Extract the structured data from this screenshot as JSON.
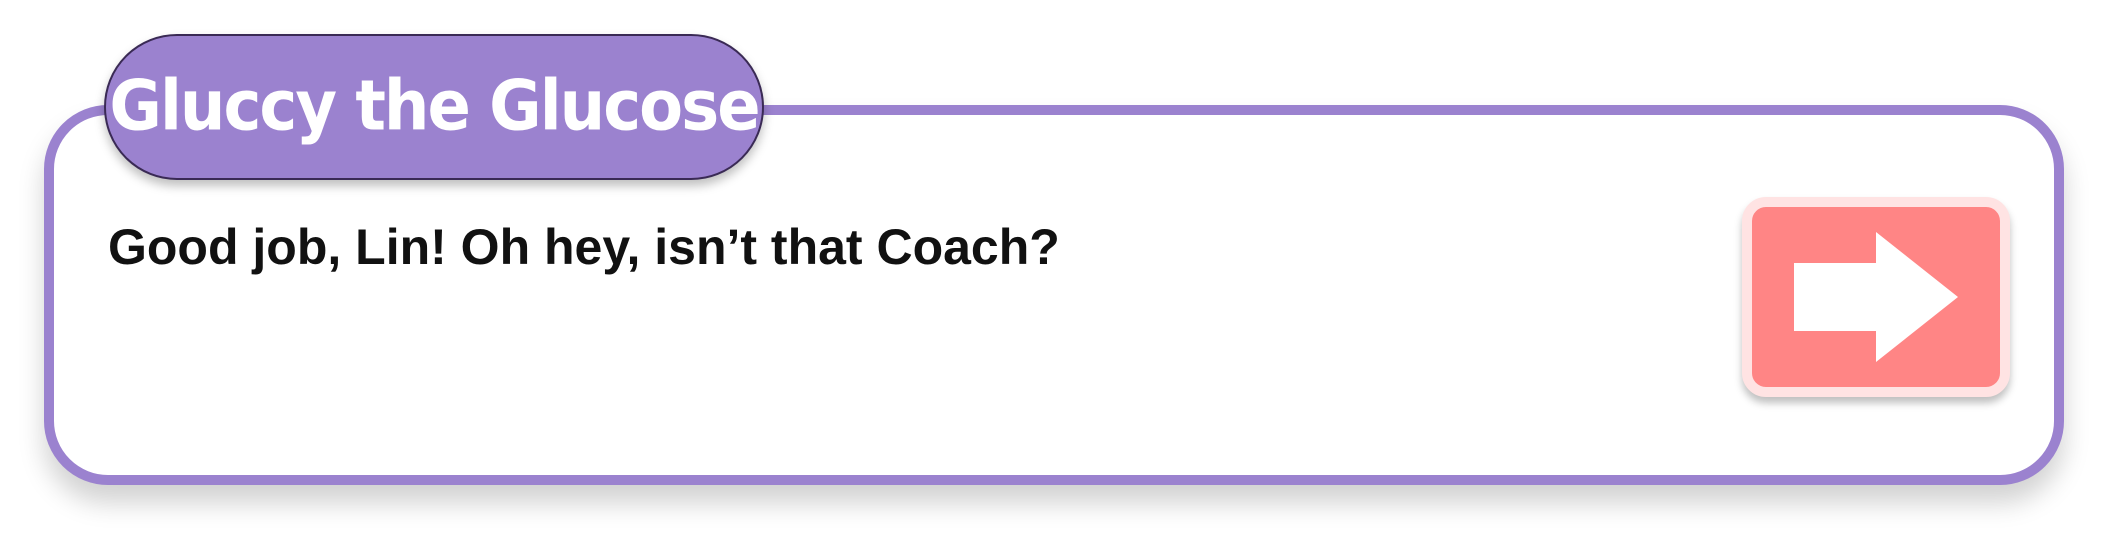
{
  "speaker": {
    "name": "Gluccy the Glucose"
  },
  "dialog": {
    "text": "Good job, Lin! Oh hey, isn’t that Coach?"
  },
  "next_button": {
    "icon": "arrow-right-icon"
  },
  "colors": {
    "frame_purple": "#9b82cf",
    "button_red": "#ff8585",
    "button_border": "#ffe3e3",
    "text": "#111111"
  }
}
